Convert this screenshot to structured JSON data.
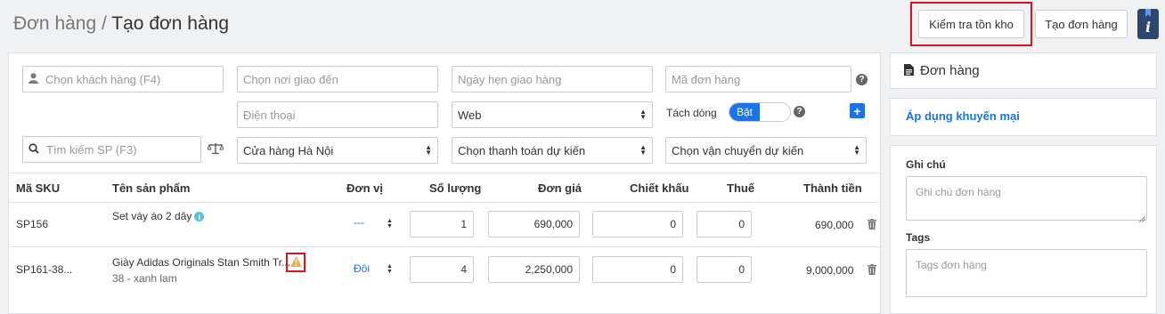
{
  "header": {
    "breadcrumb_parent": "Đơn hàng",
    "breadcrumb_sep": " / ",
    "page_title": "Tạo đơn hàng",
    "check_stock_label": "Kiểm tra tồn kho",
    "create_order_label": "Tạo đơn hàng",
    "info_glyph": "i"
  },
  "form": {
    "customer_placeholder": "Chọn khách hàng (F4)",
    "delivery_place_placeholder": "Chọn nơi giao đến",
    "delivery_date_placeholder": "Ngày hẹn giao hàng",
    "order_code_placeholder": "Mã đơn hàng",
    "phone_placeholder": "Điện thoại",
    "source_value": "Web",
    "split_line_label": "Tách dòng",
    "split_line_toggle": "Bật",
    "product_search_placeholder": "Tìm kiếm SP (F3)",
    "store_value": "Cửa hàng Hà Nội",
    "payment_value": "Chọn thanh toán dự kiến",
    "shipping_value": "Chọn vận chuyển dự kiến",
    "help_glyph": "?",
    "plus_glyph": "+"
  },
  "table": {
    "columns": [
      "Mã SKU",
      "Tên sản phẩm",
      "Đơn vị",
      "Số lượng",
      "Đơn giá",
      "Chiết khấu",
      "Thuế",
      "Thành tiền"
    ],
    "rows": [
      {
        "sku": "SP156",
        "name": "Set váy áo 2 dây",
        "variant": "",
        "unit": "---",
        "quantity": "1",
        "price": "690,000",
        "discount": "0",
        "tax": "0",
        "total": "690,000"
      },
      {
        "sku": "SP161-38...",
        "name": "Giày Adidas Originals Stan Smith Tr...",
        "variant": "38 - xanh lam",
        "unit": "Đôi",
        "quantity": "4",
        "price": "2,250,000",
        "discount": "0",
        "tax": "0",
        "total": "9,000,000"
      }
    ]
  },
  "sidebar": {
    "order_title": "Đơn hàng",
    "promo_link": "Áp dụng khuyến mại",
    "note_label": "Ghi chú",
    "note_placeholder": "Ghi chú đơn hàng",
    "tags_label": "Tags",
    "tags_placeholder": "Tags đơn hàng"
  },
  "colors": {
    "accent": "#1a73e8",
    "highlight": "#e0101d",
    "warning": "#f0ad4e"
  }
}
